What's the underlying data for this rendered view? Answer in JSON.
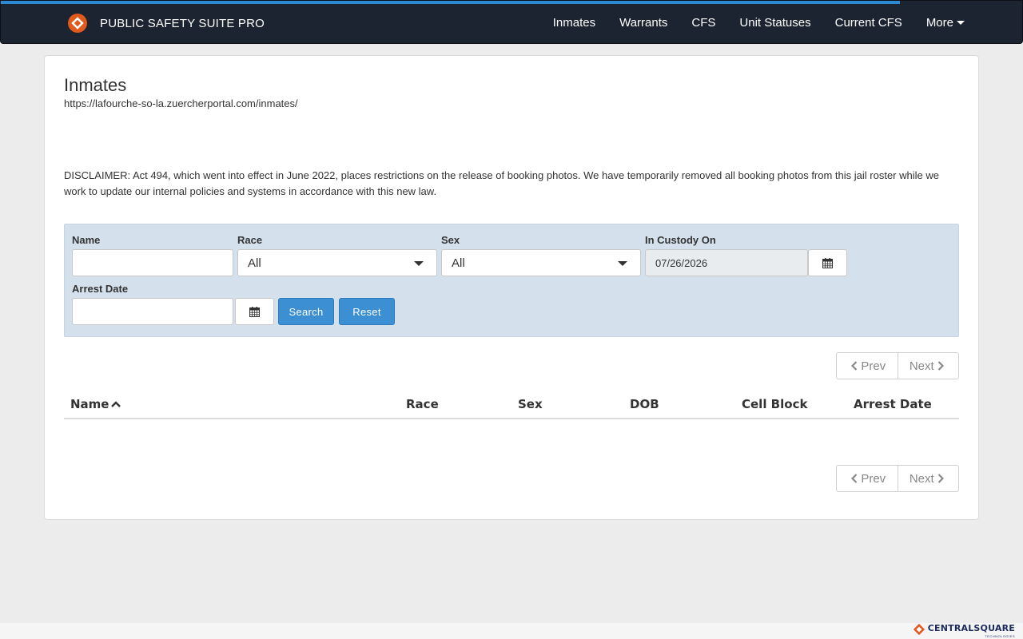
{
  "navbar": {
    "brand": "PUBLIC SAFETY SUITE PRO",
    "links": [
      "Inmates",
      "Warrants",
      "CFS",
      "Unit Statuses",
      "Current CFS"
    ],
    "more": "More",
    "loading_progress": 0.88,
    "logo_colors": {
      "primary": "#e05a1c",
      "inner": "#ffffff"
    }
  },
  "page": {
    "title": "Inmates",
    "url": "https://lafourche-so-la.zuercherportal.com/inmates/",
    "disclaimer": "DISCLAIMER: Act 494, which went into effect in June 2022, places restrictions on the release of booking photos. We have temporarily removed all booking photos from this jail roster while we work to update our internal policies and systems in accordance with this new law."
  },
  "filters": {
    "name_label": "Name",
    "name_value": "",
    "race_label": "Race",
    "race_value": "All",
    "sex_label": "Sex",
    "sex_value": "All",
    "custody_label": "In Custody On",
    "custody_value": "07/26/2026",
    "arrest_label": "Arrest Date",
    "arrest_value": "",
    "search_button": "Search",
    "reset_button": "Reset"
  },
  "pager": {
    "prev": "Prev",
    "next": "Next"
  },
  "table": {
    "columns": [
      "Name",
      "Race",
      "Sex",
      "DOB",
      "Cell Block",
      "Arrest Date"
    ],
    "sort_column": "Name",
    "sort_direction": "ascending",
    "rows": []
  },
  "footer": {
    "logo_text": "CENTRALSQUARE",
    "logo_sub": "TECHNOLOGIES",
    "colors": {
      "logo_accent": "#e8561d",
      "logo_text": "#1c2a5e"
    }
  },
  "colors": {
    "navbar_bg": "#1c2331",
    "progress": "#2b8ad1",
    "primary_button": "#3c8fd3",
    "filter_panel": "#d4e0ec"
  }
}
